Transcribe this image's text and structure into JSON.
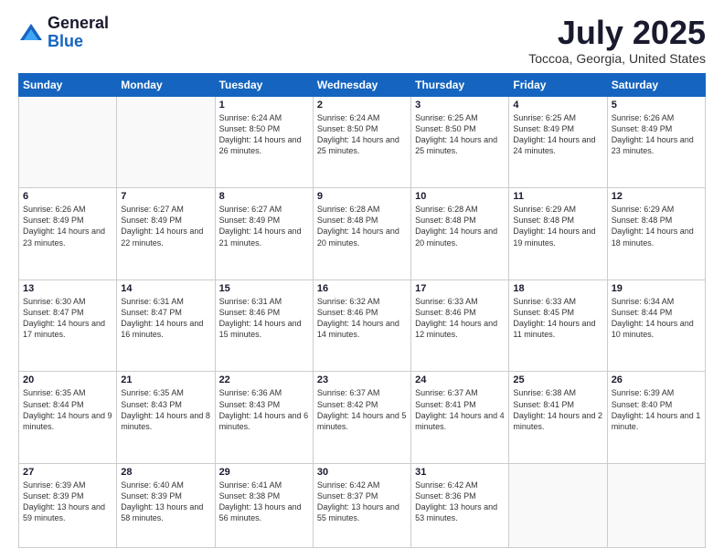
{
  "logo": {
    "general": "General",
    "blue": "Blue"
  },
  "header": {
    "month": "July 2025",
    "location": "Toccoa, Georgia, United States"
  },
  "days_of_week": [
    "Sunday",
    "Monday",
    "Tuesday",
    "Wednesday",
    "Thursday",
    "Friday",
    "Saturday"
  ],
  "weeks": [
    [
      {
        "day": "",
        "info": ""
      },
      {
        "day": "",
        "info": ""
      },
      {
        "day": "1",
        "info": "Sunrise: 6:24 AM\nSunset: 8:50 PM\nDaylight: 14 hours and 26 minutes."
      },
      {
        "day": "2",
        "info": "Sunrise: 6:24 AM\nSunset: 8:50 PM\nDaylight: 14 hours and 25 minutes."
      },
      {
        "day": "3",
        "info": "Sunrise: 6:25 AM\nSunset: 8:50 PM\nDaylight: 14 hours and 25 minutes."
      },
      {
        "day": "4",
        "info": "Sunrise: 6:25 AM\nSunset: 8:49 PM\nDaylight: 14 hours and 24 minutes."
      },
      {
        "day": "5",
        "info": "Sunrise: 6:26 AM\nSunset: 8:49 PM\nDaylight: 14 hours and 23 minutes."
      }
    ],
    [
      {
        "day": "6",
        "info": "Sunrise: 6:26 AM\nSunset: 8:49 PM\nDaylight: 14 hours and 23 minutes."
      },
      {
        "day": "7",
        "info": "Sunrise: 6:27 AM\nSunset: 8:49 PM\nDaylight: 14 hours and 22 minutes."
      },
      {
        "day": "8",
        "info": "Sunrise: 6:27 AM\nSunset: 8:49 PM\nDaylight: 14 hours and 21 minutes."
      },
      {
        "day": "9",
        "info": "Sunrise: 6:28 AM\nSunset: 8:48 PM\nDaylight: 14 hours and 20 minutes."
      },
      {
        "day": "10",
        "info": "Sunrise: 6:28 AM\nSunset: 8:48 PM\nDaylight: 14 hours and 20 minutes."
      },
      {
        "day": "11",
        "info": "Sunrise: 6:29 AM\nSunset: 8:48 PM\nDaylight: 14 hours and 19 minutes."
      },
      {
        "day": "12",
        "info": "Sunrise: 6:29 AM\nSunset: 8:48 PM\nDaylight: 14 hours and 18 minutes."
      }
    ],
    [
      {
        "day": "13",
        "info": "Sunrise: 6:30 AM\nSunset: 8:47 PM\nDaylight: 14 hours and 17 minutes."
      },
      {
        "day": "14",
        "info": "Sunrise: 6:31 AM\nSunset: 8:47 PM\nDaylight: 14 hours and 16 minutes."
      },
      {
        "day": "15",
        "info": "Sunrise: 6:31 AM\nSunset: 8:46 PM\nDaylight: 14 hours and 15 minutes."
      },
      {
        "day": "16",
        "info": "Sunrise: 6:32 AM\nSunset: 8:46 PM\nDaylight: 14 hours and 14 minutes."
      },
      {
        "day": "17",
        "info": "Sunrise: 6:33 AM\nSunset: 8:46 PM\nDaylight: 14 hours and 12 minutes."
      },
      {
        "day": "18",
        "info": "Sunrise: 6:33 AM\nSunset: 8:45 PM\nDaylight: 14 hours and 11 minutes."
      },
      {
        "day": "19",
        "info": "Sunrise: 6:34 AM\nSunset: 8:44 PM\nDaylight: 14 hours and 10 minutes."
      }
    ],
    [
      {
        "day": "20",
        "info": "Sunrise: 6:35 AM\nSunset: 8:44 PM\nDaylight: 14 hours and 9 minutes."
      },
      {
        "day": "21",
        "info": "Sunrise: 6:35 AM\nSunset: 8:43 PM\nDaylight: 14 hours and 8 minutes."
      },
      {
        "day": "22",
        "info": "Sunrise: 6:36 AM\nSunset: 8:43 PM\nDaylight: 14 hours and 6 minutes."
      },
      {
        "day": "23",
        "info": "Sunrise: 6:37 AM\nSunset: 8:42 PM\nDaylight: 14 hours and 5 minutes."
      },
      {
        "day": "24",
        "info": "Sunrise: 6:37 AM\nSunset: 8:41 PM\nDaylight: 14 hours and 4 minutes."
      },
      {
        "day": "25",
        "info": "Sunrise: 6:38 AM\nSunset: 8:41 PM\nDaylight: 14 hours and 2 minutes."
      },
      {
        "day": "26",
        "info": "Sunrise: 6:39 AM\nSunset: 8:40 PM\nDaylight: 14 hours and 1 minute."
      }
    ],
    [
      {
        "day": "27",
        "info": "Sunrise: 6:39 AM\nSunset: 8:39 PM\nDaylight: 13 hours and 59 minutes."
      },
      {
        "day": "28",
        "info": "Sunrise: 6:40 AM\nSunset: 8:39 PM\nDaylight: 13 hours and 58 minutes."
      },
      {
        "day": "29",
        "info": "Sunrise: 6:41 AM\nSunset: 8:38 PM\nDaylight: 13 hours and 56 minutes."
      },
      {
        "day": "30",
        "info": "Sunrise: 6:42 AM\nSunset: 8:37 PM\nDaylight: 13 hours and 55 minutes."
      },
      {
        "day": "31",
        "info": "Sunrise: 6:42 AM\nSunset: 8:36 PM\nDaylight: 13 hours and 53 minutes."
      },
      {
        "day": "",
        "info": ""
      },
      {
        "day": "",
        "info": ""
      }
    ]
  ]
}
